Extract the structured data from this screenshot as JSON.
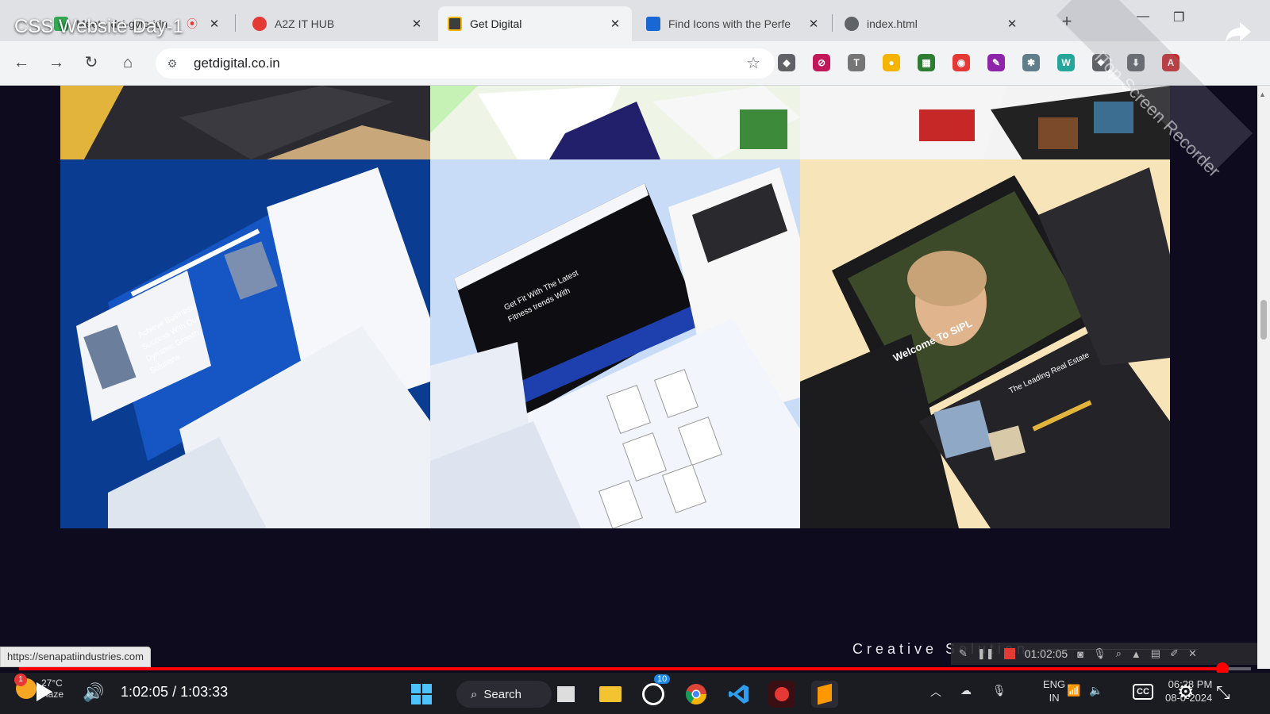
{
  "video": {
    "title": "CSS Website Day-1"
  },
  "tabs": [
    {
      "title": "Meet - dci-gvip-jdn",
      "close": "✕",
      "color": "#34a853"
    },
    {
      "title": "A2Z IT HUB",
      "close": "✕",
      "color": "#e53935"
    },
    {
      "title": "Get Digital",
      "close": "✕",
      "color": "#3d3d3d"
    },
    {
      "title": "Find Icons with the Perfe",
      "close": "✕",
      "color": "#1967d2"
    },
    {
      "title": "index.html",
      "close": "✕",
      "color": "#5f6368"
    }
  ],
  "new_tab": "+",
  "window_controls": {
    "minimize": "—",
    "maximize": "❐",
    "close": "✕"
  },
  "nav": {
    "back": "←",
    "forward": "→",
    "reload": "↻",
    "home": "⌂"
  },
  "address_bar": {
    "url": "getdigital.co.in",
    "site_info_icon": "⚙",
    "star": "☆"
  },
  "extensions": [
    {
      "name": "shield-icon",
      "color": "#5f6368",
      "glyph": "◆"
    },
    {
      "name": "block-icon",
      "color": "#c2185b",
      "glyph": "⊘"
    },
    {
      "name": "text-icon",
      "color": "#757575",
      "glyph": "T"
    },
    {
      "name": "colorwheel-icon",
      "color": "#f4b400",
      "glyph": "●"
    },
    {
      "name": "bulk-icon",
      "color": "#2e7d32",
      "glyph": "▦"
    },
    {
      "name": "record-icon",
      "color": "#e53935",
      "glyph": "◉"
    },
    {
      "name": "dropper-icon",
      "color": "#8e24aa",
      "glyph": "✎"
    },
    {
      "name": "bug-icon",
      "color": "#607d8b",
      "glyph": "✱"
    },
    {
      "name": "w-icon",
      "color": "#26a69a",
      "glyph": "W"
    },
    {
      "name": "puzzle-icon",
      "color": "#5f6368",
      "glyph": "❖"
    },
    {
      "name": "download-icon",
      "color": "#5f6368",
      "glyph": "⬇"
    },
    {
      "name": "profile-icon",
      "color": "#c62828",
      "glyph": "A"
    }
  ],
  "portfolio": {
    "cards": [
      {
        "name": "business-site-mockup",
        "headline": "Achieve Business Success With Our Dynamic Growth Solutions",
        "bg": "#0a3d91"
      },
      {
        "name": "fitness-site-mockup",
        "headline": "Get Fit With The Latest Fitness trends With",
        "bg": "#c9dcf7"
      },
      {
        "name": "realestate-site-mockup",
        "headline": "Welcome To SIPL",
        "sub": "The Leading Real Estate",
        "bg": "#f7e4b8"
      }
    ],
    "creative_solution": "Creative Solution"
  },
  "status_url": "https://senapatiindustries.com",
  "recorder": {
    "time": "01:02:05",
    "watermark": "iTop Screen Recorder"
  },
  "player": {
    "current": "1:02:05",
    "duration": "1:03:33",
    "progress": 0.977,
    "time_separator": " / "
  },
  "weather": {
    "temp": "27°C",
    "condition": "Haze",
    "badge": "1"
  },
  "taskbar": {
    "search_label": "Search",
    "whatsapp_badge": "10",
    "lang_line1": "ENG",
    "lang_line2": "IN",
    "time": "06:28 PM",
    "date": "08-0-2024",
    "cc": "CC"
  }
}
